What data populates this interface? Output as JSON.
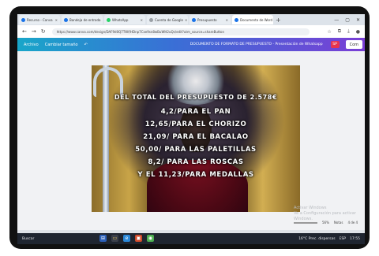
{
  "browser": {
    "tabs": [
      {
        "label": "Recurso - Canva",
        "color": "#1a73e8",
        "active": false
      },
      {
        "label": "Bandeja de entrada",
        "color": "#1a73e8",
        "active": false
      },
      {
        "label": "WhatsApp",
        "color": "#25d366",
        "active": false
      },
      {
        "label": "Cuenta de Google",
        "color": "#9aa0a6",
        "active": false
      },
      {
        "label": "Presupuesto",
        "color": "#1a73e8",
        "active": false
      },
      {
        "label": "Documento de Word",
        "color": "#1a73e8",
        "active": true
      }
    ],
    "new_tab": "+",
    "window_controls": {
      "minimize": "—",
      "maximize": "▢",
      "close": "✕"
    },
    "url": "https://www.canva.com/design/DAF9d0Q7TWf/HDnp7Cxe9sn8wBuWH2uQs/edit?utm_source=shareButton",
    "nav": {
      "back": "←",
      "forward": "→",
      "reload": "↻"
    }
  },
  "canva_bar": {
    "home": "Archivo",
    "resize": "Cambiar tamaño",
    "undo": "↶",
    "title": "DOCUMENTO DE FORMATO DE PRESUPUESTO - Presentación de Whatsapp",
    "avatar_text": "SP",
    "share_label": "Com"
  },
  "slide": {
    "lines": [
      "DEL TOTAL DEL PRESUPUESTO DE 2.578€",
      "4,2/PARA EL PAN",
      "12,65/PARA EL CHORIZO",
      "21,09/ PARA EL BACALAO",
      "50,00/ PARA LAS PALETILLAS",
      "8,2/ PARA LAS ROSCAS",
      "Y EL 11,23/PARA MEDALLAS"
    ]
  },
  "watermark": {
    "line1": "Activar Windows",
    "line2": "Ve a Configuración para activar Windows."
  },
  "zoom": {
    "label": "Notas",
    "value": "56%",
    "pages": "4 de 4"
  },
  "taskbar": {
    "weather": "Buscar",
    "tray_weather": "16°C Prec. dispersas",
    "time": "17:55",
    "lang": "ESP"
  }
}
